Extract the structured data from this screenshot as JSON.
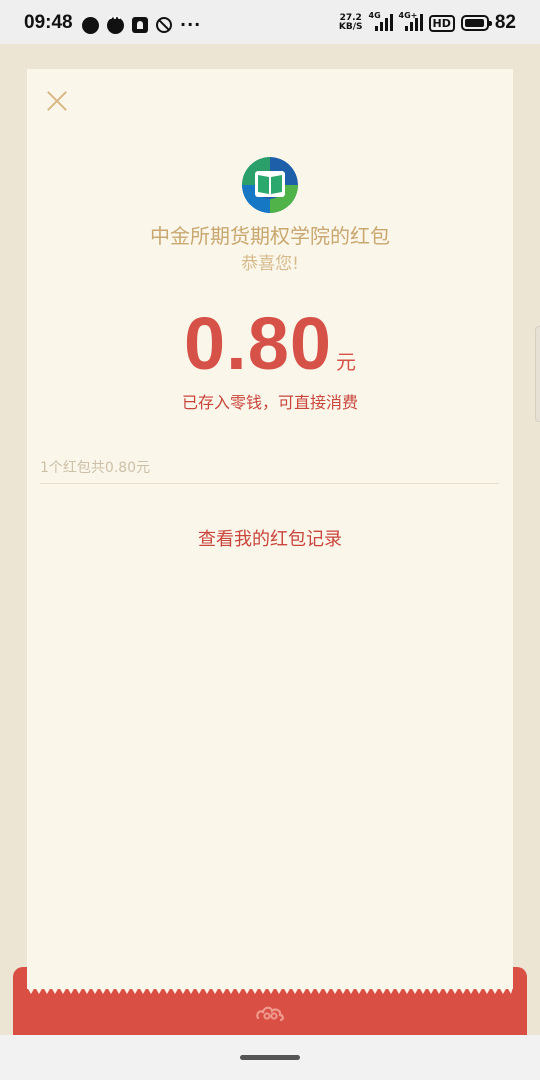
{
  "status_bar": {
    "time": "09:48",
    "net_speed_top": "27.2",
    "net_speed_bottom": "KB/S",
    "sim1_tag": "4G",
    "sim2_tag": "4G+",
    "hd": "HD",
    "battery_level": "82",
    "more": "···"
  },
  "redpacket": {
    "sender": "中金所期货期权学院的红包",
    "greeting": "恭喜您!",
    "amount": "0.80",
    "unit": "元",
    "deposited_note": "已存入零钱，可直接消费",
    "summary": "1个红包共0.80元",
    "record_link": "查看我的红包记录"
  },
  "colors": {
    "accent_red": "#d65148",
    "gold": "#c8a870",
    "card_bg": "#fbf6ea",
    "page_bg": "#ede5d3"
  }
}
